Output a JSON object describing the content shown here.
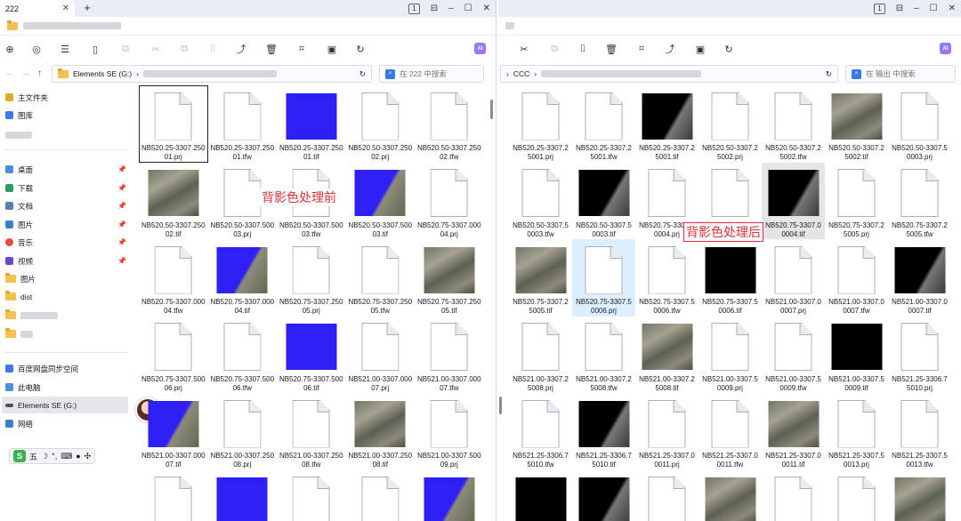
{
  "left_window": {
    "tab_title": "222",
    "tab_count": "1",
    "address": {
      "drive": "Elements SE (G:)"
    },
    "search_placeholder": "在 222 中搜索",
    "sidebar": {
      "home": "主文件夹",
      "gallery": "图库",
      "desktop": "桌面",
      "downloads": "下载",
      "documents": "文档",
      "pictures": "图片",
      "music": "音乐",
      "videos": "视频",
      "pictures2": "图片",
      "dist": "dist",
      "baidu": "百度网盘同步空间",
      "this_pc": "此电脑",
      "drive": "Elements SE (G:)",
      "network": "网络"
    },
    "ime_label": "五",
    "overlay_label": "背影色处理前",
    "files": [
      {
        "name": "NB520.25-3307.25001.prj",
        "kind": "doc"
      },
      {
        "name": "NB520.25-3307.25001.tfw",
        "kind": "doc"
      },
      {
        "name": "NB520.25-3307.25001.tif",
        "kind": "blue"
      },
      {
        "name": "NB520.50-3307.25002.prj",
        "kind": "doc"
      },
      {
        "name": "NB520.50-3307.25002.tfw",
        "kind": "doc"
      },
      {
        "name": "NB520.50-3307.25002.tif",
        "kind": "aerial"
      },
      {
        "name": "NB520.50-3307.50003.prj",
        "kind": "doc"
      },
      {
        "name": "NB520.50-3307.50003.tfw",
        "kind": "doc"
      },
      {
        "name": "NB520.50-3307.50003.tif",
        "kind": "blue-edge"
      },
      {
        "name": "NB520.75-3307.00004.prj",
        "kind": "doc"
      },
      {
        "name": "NB520.75-3307.00004.tfw",
        "kind": "doc"
      },
      {
        "name": "NB520.75-3307.00004.tif",
        "kind": "blue-edge"
      },
      {
        "name": "NB520.75-3307.25005.prj",
        "kind": "doc"
      },
      {
        "name": "NB520.75-3307.25005.tfw",
        "kind": "doc"
      },
      {
        "name": "NB520.75-3307.25005.tif",
        "kind": "aerial"
      },
      {
        "name": "NB520.75-3307.50006.prj",
        "kind": "doc"
      },
      {
        "name": "NB520.75-3307.50006.tfw",
        "kind": "doc"
      },
      {
        "name": "NB520.75-3307.50006.tif",
        "kind": "blue"
      },
      {
        "name": "NB521.00-3307.00007.prj",
        "kind": "doc"
      },
      {
        "name": "NB521.00-3307.00007.tfw",
        "kind": "doc"
      },
      {
        "name": "NB521.00-3307.00007.tif",
        "kind": "blue-edge"
      },
      {
        "name": "NB521.00-3307.25008.prj",
        "kind": "doc"
      },
      {
        "name": "NB521.00-3307.25008.tfw",
        "kind": "doc"
      },
      {
        "name": "NB521.00-3307.25008.tif",
        "kind": "aerial"
      },
      {
        "name": "NB521.00-3307.50009.prj",
        "kind": "doc"
      },
      {
        "name": "",
        "kind": "doc"
      },
      {
        "name": "",
        "kind": "blue"
      },
      {
        "name": "",
        "kind": "doc"
      },
      {
        "name": "",
        "kind": "doc"
      },
      {
        "name": "",
        "kind": "blue-edge"
      }
    ]
  },
  "right_window": {
    "tab_count": "1",
    "address": {
      "folder": "CCC"
    },
    "search_placeholder": "在 输出 中搜索",
    "overlay_label": "背影色处理后",
    "files": [
      {
        "name": "NB520.25-3307.25001.prj",
        "kind": "doc"
      },
      {
        "name": "NB520.25-3307.25001.tfw",
        "kind": "doc"
      },
      {
        "name": "NB520.25-3307.25001.tif",
        "kind": "black-edge"
      },
      {
        "name": "NB520.50-3307.25002.prj",
        "kind": "doc"
      },
      {
        "name": "NB520.50-3307.25002.tfw",
        "kind": "doc"
      },
      {
        "name": "NB520.50-3307.25002.tif",
        "kind": "aerial"
      },
      {
        "name": "NB520.50-3307.50003.prj",
        "kind": "doc"
      },
      {
        "name": "NB520.50-3307.50003.tfw",
        "kind": "doc"
      },
      {
        "name": "NB520.50-3307.50003.tif",
        "kind": "black-edge"
      },
      {
        "name": "NB520.75-3307.00004.prj",
        "kind": "doc"
      },
      {
        "name": "NB520.75-3307.00004.tfw",
        "kind": "doc"
      },
      {
        "name": "NB520.75-3307.00004.tif",
        "kind": "black-edge"
      },
      {
        "name": "NB520.75-3307.25005.prj",
        "kind": "doc"
      },
      {
        "name": "NB520.75-3307.25005.tfw",
        "kind": "doc"
      },
      {
        "name": "NB520.75-3307.25005.tif",
        "kind": "aerial"
      },
      {
        "name": "NB520.75-3307.50006.prj",
        "kind": "doc"
      },
      {
        "name": "NB520.75-3307.50006.tfw",
        "kind": "doc"
      },
      {
        "name": "NB520.75-3307.50006.tif",
        "kind": "black"
      },
      {
        "name": "NB521.00-3307.00007.prj",
        "kind": "doc"
      },
      {
        "name": "NB521.00-3307.00007.tfw",
        "kind": "doc"
      },
      {
        "name": "NB521.00-3307.00007.tif",
        "kind": "black-edge"
      },
      {
        "name": "NB521.00-3307.25008.prj",
        "kind": "doc"
      },
      {
        "name": "NB521.00-3307.25008.tfw",
        "kind": "doc"
      },
      {
        "name": "NB521.00-3307.25008.tif",
        "kind": "aerial"
      },
      {
        "name": "NB521.00-3307.50009.prj",
        "kind": "doc"
      },
      {
        "name": "NB521.00-3307.50009.tfw",
        "kind": "doc"
      },
      {
        "name": "NB521.00-3307.50009.tif",
        "kind": "black"
      },
      {
        "name": "NB521.25-3306.75010.prj",
        "kind": "doc"
      },
      {
        "name": "NB521.25-3306.75010.tfw",
        "kind": "doc"
      },
      {
        "name": "NB521.25-3306.75010.tif",
        "kind": "black-edge"
      },
      {
        "name": "NB521.25-3307.00011.prj",
        "kind": "doc"
      },
      {
        "name": "NB521.25-3307.00011.tfw",
        "kind": "doc"
      },
      {
        "name": "NB521.25-3307.00011.tif",
        "kind": "aerial"
      },
      {
        "name": "NB521.25-3307.50013.prj",
        "kind": "doc"
      },
      {
        "name": "NB521.25-3307.50013.tfw",
        "kind": "doc"
      },
      {
        "name": "",
        "kind": "black"
      },
      {
        "name": "",
        "kind": "black-edge"
      },
      {
        "name": "",
        "kind": "doc"
      },
      {
        "name": "",
        "kind": "aerial"
      },
      {
        "name": "",
        "kind": "doc"
      },
      {
        "name": "",
        "kind": "doc"
      },
      {
        "name": "",
        "kind": "aerial"
      }
    ]
  },
  "colors": {
    "accent": "#3b79e6",
    "overlay_red": "#e0313a",
    "thumb_blue": "#2e1ff5",
    "thumb_black": "#000000"
  }
}
